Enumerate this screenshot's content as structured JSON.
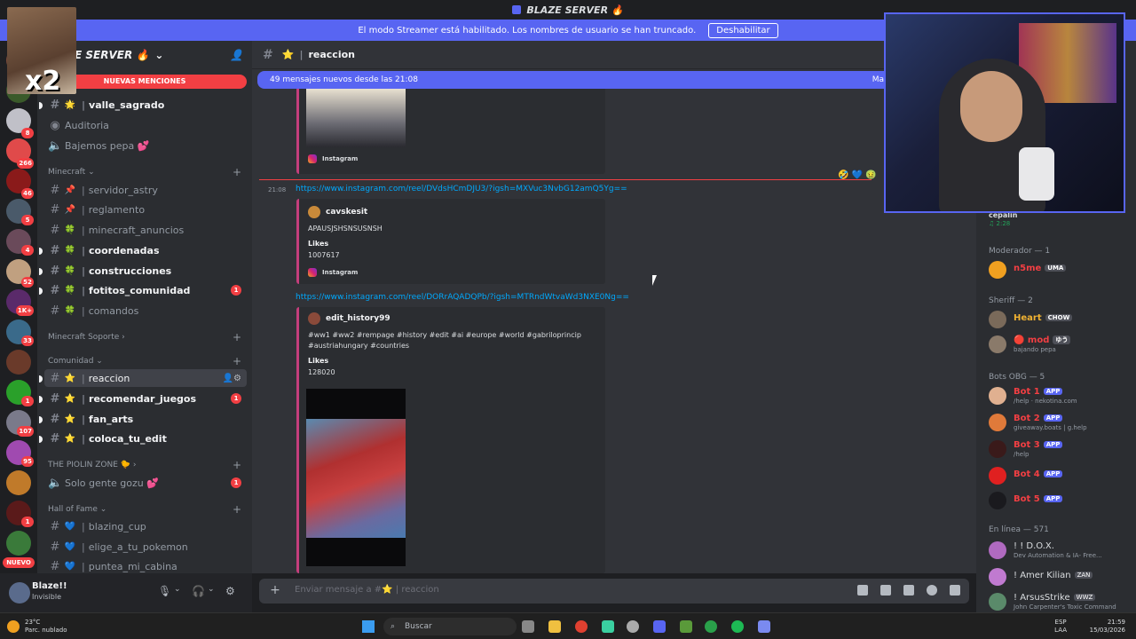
{
  "title_bar": {
    "title": "BLAZE SERVER 🔥"
  },
  "streamer_banner": {
    "text": "El modo Streamer está habilitado. Los nombres de usuario se han truncado.",
    "button": "Deshabilitar"
  },
  "server": {
    "name": "E SERVER 🔥",
    "mentions_label": "NUEVAS MENCIONES"
  },
  "server_rail_badges": [
    "8",
    "266",
    "46",
    "5",
    "4",
    "52",
    "1K+",
    "33",
    "1",
    "107",
    "95",
    "1"
  ],
  "server_rail_new": "NUEVO",
  "sidebar": {
    "channels_top": [
      {
        "name": "valle_sagrado",
        "emoji": "🌟",
        "unread": true
      },
      {
        "name": "Auditoria",
        "emoji": "",
        "voice": true
      },
      {
        "name": "Bajemos pepa 💕",
        "emoji": "",
        "voice": true
      }
    ],
    "cat_minecraft": "Minecraft",
    "minecraft": [
      {
        "name": "servidor_astry",
        "emoji": "📌"
      },
      {
        "name": "reglamento",
        "emoji": "📌"
      },
      {
        "name": "minecraft_anuncios",
        "emoji": "🍀"
      },
      {
        "name": "coordenadas",
        "emoji": "🍀",
        "unread": true
      },
      {
        "name": "construcciones",
        "emoji": "🍀",
        "unread": true
      },
      {
        "name": "fotitos_comunidad",
        "emoji": "🍀",
        "unread": true,
        "count": "1"
      },
      {
        "name": "comandos",
        "emoji": "🍀"
      }
    ],
    "cat_soporte": "Minecraft Soporte",
    "cat_comunidad": "Comunidad",
    "comunidad": [
      {
        "name": "reaccion",
        "emoji": "⭐",
        "active": true
      },
      {
        "name": "recomendar_juegos",
        "emoji": "⭐",
        "unread": true,
        "count": "1"
      },
      {
        "name": "fan_arts",
        "emoji": "⭐",
        "unread": true
      },
      {
        "name": "coloca_tu_edit",
        "emoji": "⭐",
        "unread": true
      }
    ],
    "cat_piolin": "THE PIOLIN ZONE 🐤",
    "piolin": [
      {
        "name": "Solo gente gozu 💕",
        "count": "1"
      }
    ],
    "cat_hall": "Hall of Fame",
    "hall": [
      {
        "name": "blazing_cup",
        "emoji": "💙"
      },
      {
        "name": "elige_a_tu_pokemon",
        "emoji": "💙"
      },
      {
        "name": "puntea_mi_cabina",
        "emoji": "💙"
      }
    ]
  },
  "user_panel": {
    "name": "Blaze!!",
    "status": "Invisible"
  },
  "channel_header": {
    "name": "reaccion",
    "emoji": "⭐"
  },
  "new_messages_bar": {
    "text": "49 mensajes nuevos desde las 21:08",
    "right": "Ma"
  },
  "messages": [
    {
      "embed_footer": "Instagram"
    },
    {
      "time": "21:08",
      "link": "https://www.instagram.com/reel/DVdsHCmDJU3/?igsh=MXVuc3NvbG12amQ5Yg==",
      "author": "cavskesit",
      "text": "APAUSJSHSNSUSNSH",
      "field_name": "Likes",
      "field_value": "1007617",
      "footer": "Instagram"
    },
    {
      "link": "https://www.instagram.com/reel/DORrAQADQPb/?igsh=MTRndWtvaWd3NXE0Ng==",
      "author": "edit_history99",
      "text1": "#ww1 #ww2 #rempage #history #edit #ai #europe #world #gabriloprincip",
      "text2": "#austriahungary #countries",
      "field_name": "Likes",
      "field_value": "128020"
    }
  ],
  "composer": {
    "placeholder": "Enviar mensaje a #⭐ | reaccion"
  },
  "members": {
    "top_name": "cepalin",
    "top_status": "♫ 2:28",
    "groups": [
      {
        "label": "Moderador — 1",
        "items": [
          {
            "name": "n5me",
            "tag": "UMA",
            "color": "#f23f43"
          }
        ]
      },
      {
        "label": "Sheriff — 2",
        "items": [
          {
            "name": "Heart",
            "tag": "CHOW",
            "color": "#f0b232"
          },
          {
            "name": "🔴 mod",
            "tag": "ゆう",
            "color": "#f23f43",
            "status": "bajando pepa"
          }
        ]
      },
      {
        "label": "Bots OBG — 5",
        "items": [
          {
            "name": "Bot 1",
            "tag": "APP",
            "color": "#f23f43",
            "status": "/help · nekotina.com"
          },
          {
            "name": "Bot 2",
            "tag": "APP",
            "color": "#f23f43",
            "status": "giveaway.boats | g.help"
          },
          {
            "name": "Bot 3",
            "tag": "APP",
            "color": "#f23f43",
            "status": "/help"
          },
          {
            "name": "Bot 4",
            "tag": "APP",
            "color": "#f23f43"
          },
          {
            "name": "Bot 5",
            "tag": "APP",
            "color": "#f23f43"
          }
        ]
      },
      {
        "label": "En línea — 571",
        "items": [
          {
            "name": "! ! D.O.X.",
            "color": "#dbdee1",
            "status": "Dev Automation & IA- Free..."
          },
          {
            "name": "! Amer Kilian",
            "tag": "ZAN",
            "color": "#dbdee1"
          },
          {
            "name": "! ArsusStrike",
            "tag": "WWZ",
            "color": "#dbdee1",
            "status": "John Carpenter's Toxic Command"
          }
        ]
      }
    ]
  },
  "taskbar": {
    "weather_temp": "23°C",
    "weather_desc": "Parc. nublado",
    "search": "Buscar",
    "lang1": "ESP",
    "lang2": "LAA",
    "time": "21:59",
    "date": "15/03/2026"
  },
  "colors": {
    "accent": "#5865f2",
    "danger": "#f23f43",
    "embed_border": "#c43e7c",
    "link": "#00a8fc"
  }
}
